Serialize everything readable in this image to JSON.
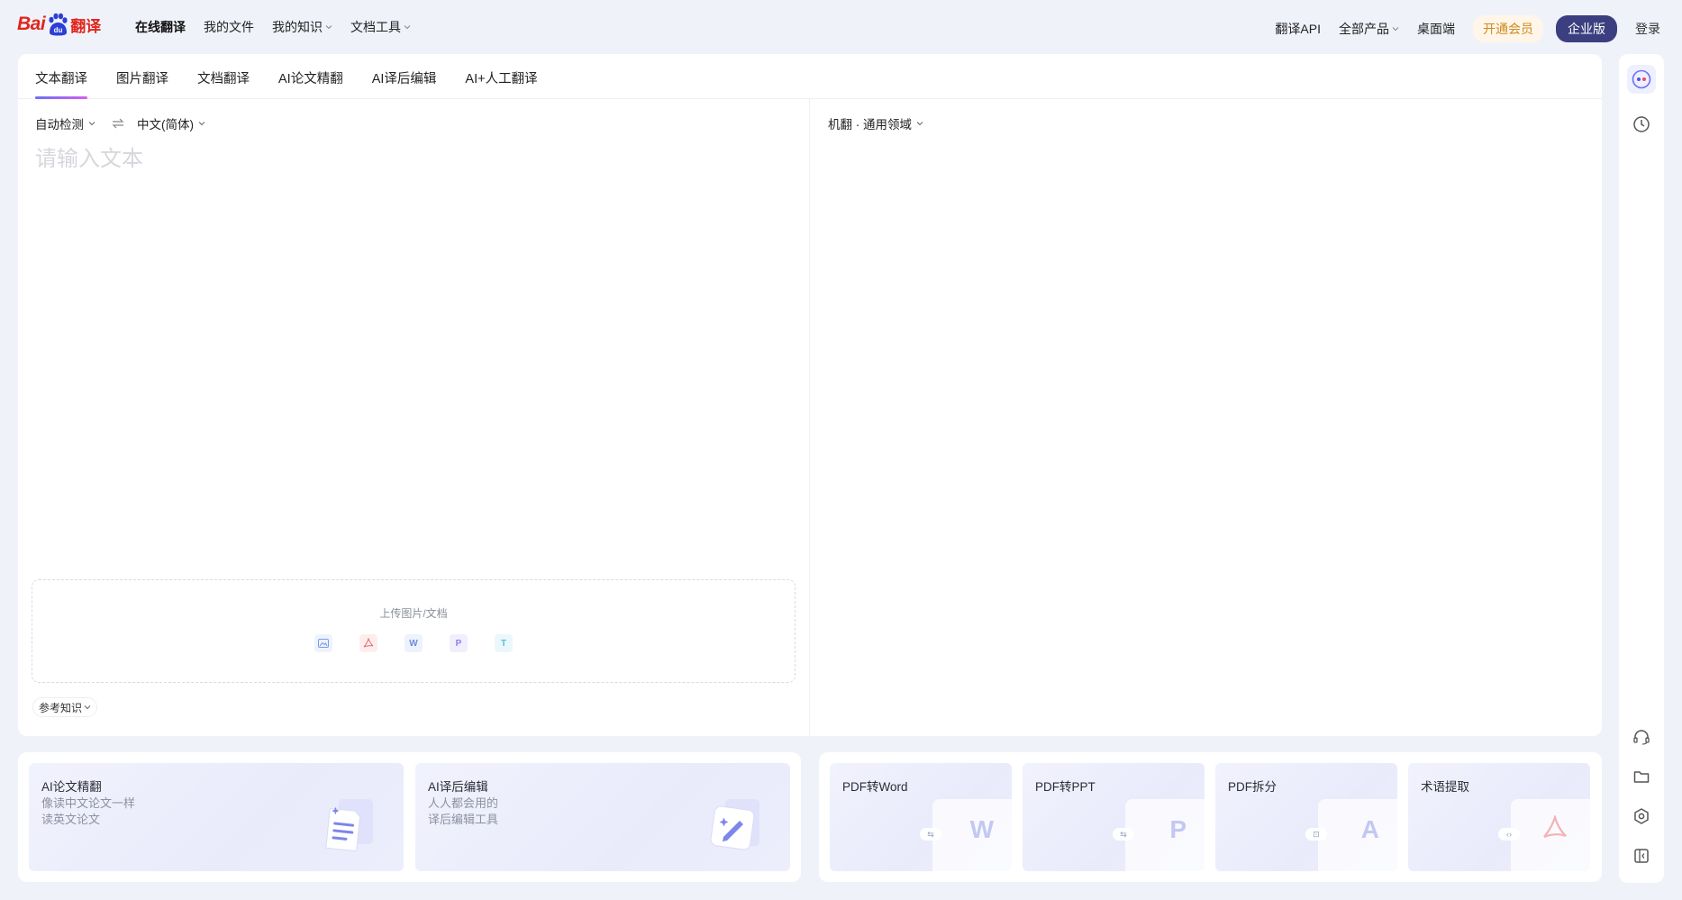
{
  "brand": {
    "bai": "Bai",
    "du": "du",
    "translate": "翻译"
  },
  "nav": {
    "left": [
      {
        "label": "在线翻译",
        "dropdown": false,
        "active": true
      },
      {
        "label": "我的文件",
        "dropdown": false
      },
      {
        "label": "我的知识",
        "dropdown": true
      },
      {
        "label": "文档工具",
        "dropdown": true
      }
    ],
    "right": {
      "api": "翻译API",
      "products": "全部产品",
      "desktop": "桌面端",
      "vip": "开通会员",
      "enterprise": "企业版",
      "login": "登录"
    }
  },
  "tabs": [
    "文本翻译",
    "图片翻译",
    "文档翻译",
    "AI论文精翻",
    "AI译后编辑",
    "AI+人工翻译"
  ],
  "source": {
    "from_lang": "自动检测",
    "to_lang": "中文(简体)",
    "placeholder": "请输入文本",
    "upload_label": "上传图片/文档",
    "upload_types": [
      "image-icon",
      "pdf-icon",
      "word-icon",
      "ppt-icon",
      "text-icon"
    ],
    "reference": "参考知识"
  },
  "target": {
    "engine": "机翻 · 通用领域"
  },
  "feature_cards": [
    {
      "title": "AI论文精翻",
      "desc1": "像读中文论文一样",
      "desc2": "读英文论文"
    },
    {
      "title": "AI译后编辑",
      "desc1": "人人都会用的",
      "desc2": "译后编辑工具"
    }
  ],
  "tool_cards": [
    {
      "title": "PDF转Word",
      "glyph": "W"
    },
    {
      "title": "PDF转PPT",
      "glyph": "P"
    },
    {
      "title": "PDF拆分",
      "glyph": "A"
    },
    {
      "title": "术语提取",
      "glyph": ""
    }
  ],
  "colors": {
    "brand_red": "#e1251b",
    "accent": "#6b6ff7",
    "enterprise_bg": "#3b3f80",
    "vip_text": "#d08a1d"
  }
}
